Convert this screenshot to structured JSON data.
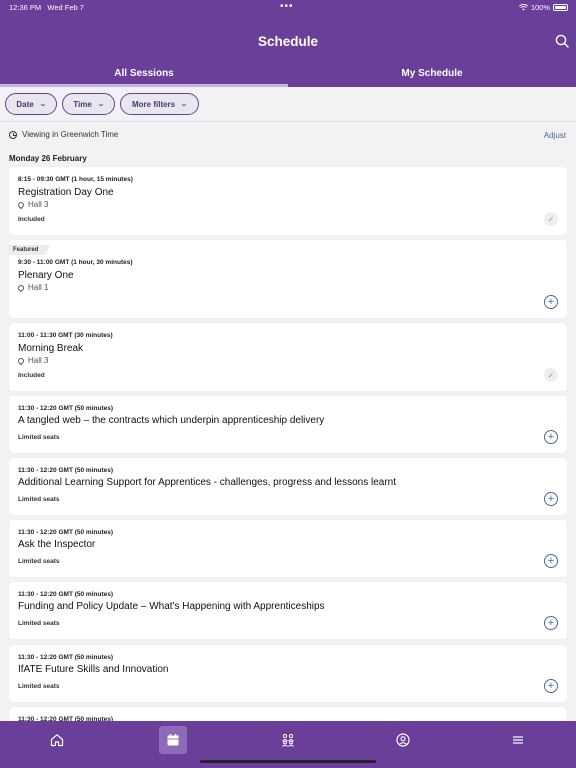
{
  "status_bar": {
    "time": "12:36 PM",
    "date": "Wed Feb 7",
    "battery": "100%"
  },
  "header": {
    "title": "Schedule",
    "tabs": [
      {
        "label": "All Sessions",
        "active": true
      },
      {
        "label": "My Schedule",
        "active": false
      }
    ]
  },
  "filters": [
    {
      "label": "Date"
    },
    {
      "label": "Time"
    },
    {
      "label": "More filters"
    }
  ],
  "timezone": {
    "label": "Viewing in Greenwich Time",
    "adjust_label": "Adjust"
  },
  "day_label": "Monday 26 February",
  "sessions": [
    {
      "time": "8:15 - 09:30 GMT (1 hour, 15 minutes)",
      "title": "Registration Day One",
      "location": "Hall 3",
      "status": "Included",
      "action": "check"
    },
    {
      "badge": "Featured",
      "time": "9:30 - 11:00 GMT (1 hour, 30 minutes)",
      "title": "Plenary One",
      "location": "Hall 1",
      "status": "",
      "action": "add"
    },
    {
      "time": "11:00 - 11:30 GMT (30 minutes)",
      "title": "Morning Break",
      "location": "Hall 3",
      "status": "Included",
      "action": "check"
    },
    {
      "time": "11:30 - 12:20 GMT (50 minutes)",
      "title": "A tangled web – the contracts which underpin apprenticeship delivery",
      "status": "Limited seats",
      "action": "add"
    },
    {
      "time": "11:30 - 12:20 GMT (50 minutes)",
      "title": "Additional Learning Support for Apprentices - challenges, progress and lessons learnt",
      "status": "Limited seats",
      "action": "add"
    },
    {
      "time": "11:30 - 12:20 GMT (50 minutes)",
      "title": "Ask the Inspector",
      "status": "Limited seats",
      "action": "add"
    },
    {
      "time": "11:30 - 12:20 GMT (50 minutes)",
      "title": "Funding and Policy Update – What's Happening with Apprenticeships",
      "status": "Limited seats",
      "action": "add"
    },
    {
      "time": "11:30 - 12:20 GMT (50 minutes)",
      "title": "IfATE Future Skills and Innovation",
      "status": "Limited seats",
      "action": "add"
    },
    {
      "time": "11:30 - 12:20 GMT (50 minutes)",
      "title": "",
      "status": "",
      "action": ""
    }
  ],
  "bottom_nav": [
    {
      "icon": "home-icon",
      "active": false
    },
    {
      "icon": "schedule-icon",
      "active": true
    },
    {
      "icon": "people-icon",
      "active": false
    },
    {
      "icon": "profile-icon",
      "active": false
    },
    {
      "icon": "menu-icon",
      "active": false
    }
  ],
  "colors": {
    "brand": "#6a3f99",
    "accent_link": "#4b6a8a",
    "background": "#f2f2f4"
  }
}
